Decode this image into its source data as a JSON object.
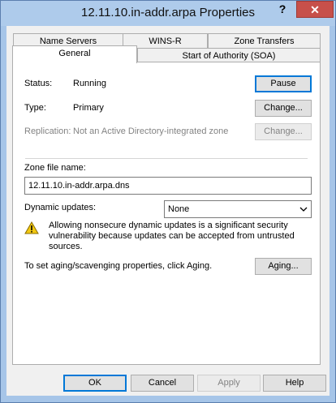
{
  "window": {
    "title": "12.11.10.in-addr.arpa Properties",
    "help_glyph": "?",
    "close_glyph": "✕"
  },
  "tabs": {
    "row1": [
      "Name Servers",
      "WINS-R",
      "Zone Transfers"
    ],
    "row2": [
      "General",
      "Start of Authority (SOA)"
    ],
    "active": "General"
  },
  "general": {
    "status_label": "Status:",
    "status_value": "Running",
    "pause_label": "Pause",
    "type_label": "Type:",
    "type_value": "Primary",
    "change_type_label": "Change...",
    "replication_label": "Replication:",
    "replication_value": "Not an Active Directory-integrated zone",
    "change_replication_label": "Change...",
    "zone_file_label": "Zone file name:",
    "zone_file_value": "12.11.10.in-addr.arpa.dns",
    "dynamic_updates_label": "Dynamic updates:",
    "dynamic_updates_value": "None",
    "warning_text": "Allowing nonsecure dynamic updates is a significant security vulnerability because updates can be accepted from untrusted sources.",
    "aging_text": "To set aging/scavenging properties, click Aging.",
    "aging_label": "Aging..."
  },
  "footer": {
    "ok": "OK",
    "cancel": "Cancel",
    "apply": "Apply",
    "help": "Help"
  }
}
